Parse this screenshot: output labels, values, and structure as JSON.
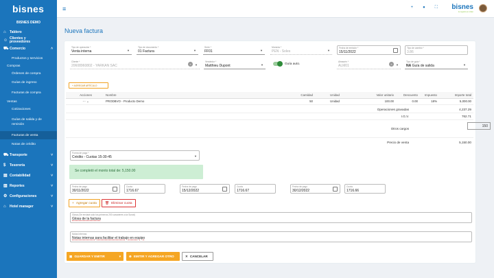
{
  "sidebar": {
    "logo": "bisnes",
    "company": "BISNES DEMO",
    "items": [
      {
        "label": "Tablero",
        "icon": "home-icon"
      },
      {
        "label": "Clientes y proveedores",
        "icon": "users-icon"
      },
      {
        "label": "Comercio",
        "icon": "cart-icon"
      },
      {
        "label": "Productos y servicios"
      },
      {
        "label": "Compras"
      },
      {
        "label": "Órdenes de compra"
      },
      {
        "label": "Guías de ingreso"
      },
      {
        "label": "Facturas de compra"
      },
      {
        "label": "Ventas"
      },
      {
        "label": "Cotizaciones"
      },
      {
        "label": "Guías de salida y de remisión"
      },
      {
        "label": "Facturas de venta"
      },
      {
        "label": "Notas de crédito"
      },
      {
        "label": "Transporte",
        "icon": "truck-icon"
      },
      {
        "label": "Tesorería",
        "icon": "money-icon"
      },
      {
        "label": "Contabilidad",
        "icon": "ledger-icon"
      },
      {
        "label": "Reportes",
        "icon": "chart-icon"
      },
      {
        "label": "Configuraciones",
        "icon": "gear-icon"
      },
      {
        "label": "Hotel manager",
        "icon": "hotel-icon"
      }
    ]
  },
  "topbar": {
    "brand": "bisnes",
    "brand_sub": "tu negocio en orden"
  },
  "page": {
    "title": "Nueva factura"
  },
  "form": {
    "tipo_op_label": "Tipo de operación *",
    "tipo_op": "Venta interna",
    "tipo_doc_label": "Tipo de documento *",
    "tipo_doc": "01 Factura",
    "serie_label": "Serie *",
    "serie": "FF01",
    "moneda_label": "Moneda *",
    "moneda": "PEN - Soles",
    "fecha_label": "Fecha de emisión *",
    "fecha": "15/11/2022",
    "tc_label": "Tipo de cambio *",
    "tc": "3.86",
    "cliente_label": "Cliente *",
    "cliente": "20608960802 - YARKAN SAC",
    "vendedor_label": "Vendedor *",
    "vendedor": "Matthieu Dupont",
    "guia_auto": "Guía auto.",
    "almacen_label": "Almacén *",
    "almacen": "ALM01",
    "tipo_guia_label": "Tipo de guía *",
    "tipo_guia_code": "NA",
    "tipo_guia": "Guía de salida"
  },
  "add_article": "+ AGREGAR ARTÍCULO",
  "table": {
    "headers": [
      "Acciones",
      "Nombre",
      "Cantidad",
      "Unidad",
      "Valor unitario",
      "Descuento",
      "Impuesto",
      "Importe total"
    ],
    "rows": [
      [
        "PRODBVO - Producto Demo",
        "50",
        "Unidad",
        "100.00",
        "0.00",
        "18%",
        "5,000.00"
      ]
    ]
  },
  "totals": {
    "gravadas_label": "Operaciones gravadas",
    "gravadas": "4,237.29",
    "igv_label": "I.G.V.",
    "igv": "762.71",
    "otros_label": "Otros cargos",
    "otros": "150",
    "precio_label": "Precio de venta",
    "precio": "5,150.00"
  },
  "pago": {
    "label": "Forma de pago *",
    "value": "Crédito - Cuotas 15-30-45"
  },
  "alert": "Se completó el monto total de: 5,150.00",
  "cuotas": [
    {
      "fecha_label": "Fecha de pago",
      "fecha": "30/11/2022",
      "cuota_label": "Cuota",
      "cuota": "1716.67"
    },
    {
      "fecha_label": "Fecha de pago",
      "fecha": "15/12/2022",
      "cuota_label": "Cuota",
      "cuota": "1716.67"
    },
    {
      "fecha_label": "Fecha de pago",
      "fecha": "30/12/2022",
      "cuota_label": "Cuota",
      "cuota": "1716.66"
    }
  ],
  "btn_agregar_cuota": "Agregar cuota",
  "btn_eliminar_cuota": "Eliminar cuota",
  "glosa": {
    "label": "Glosa (Se enviará sólo los primeros 200 caracteres a la Sunat)",
    "value": "Glosa de la factura"
  },
  "notas": {
    "label": "Notas internas",
    "value": "Notas internas para facilitar el trabajo en equipo"
  },
  "actions": {
    "guardar": "GUARDAR Y EMITIR",
    "emitir_nuevo": "EMITIR Y AGREGAR OTRO",
    "cancelar": "CANCELAR"
  }
}
